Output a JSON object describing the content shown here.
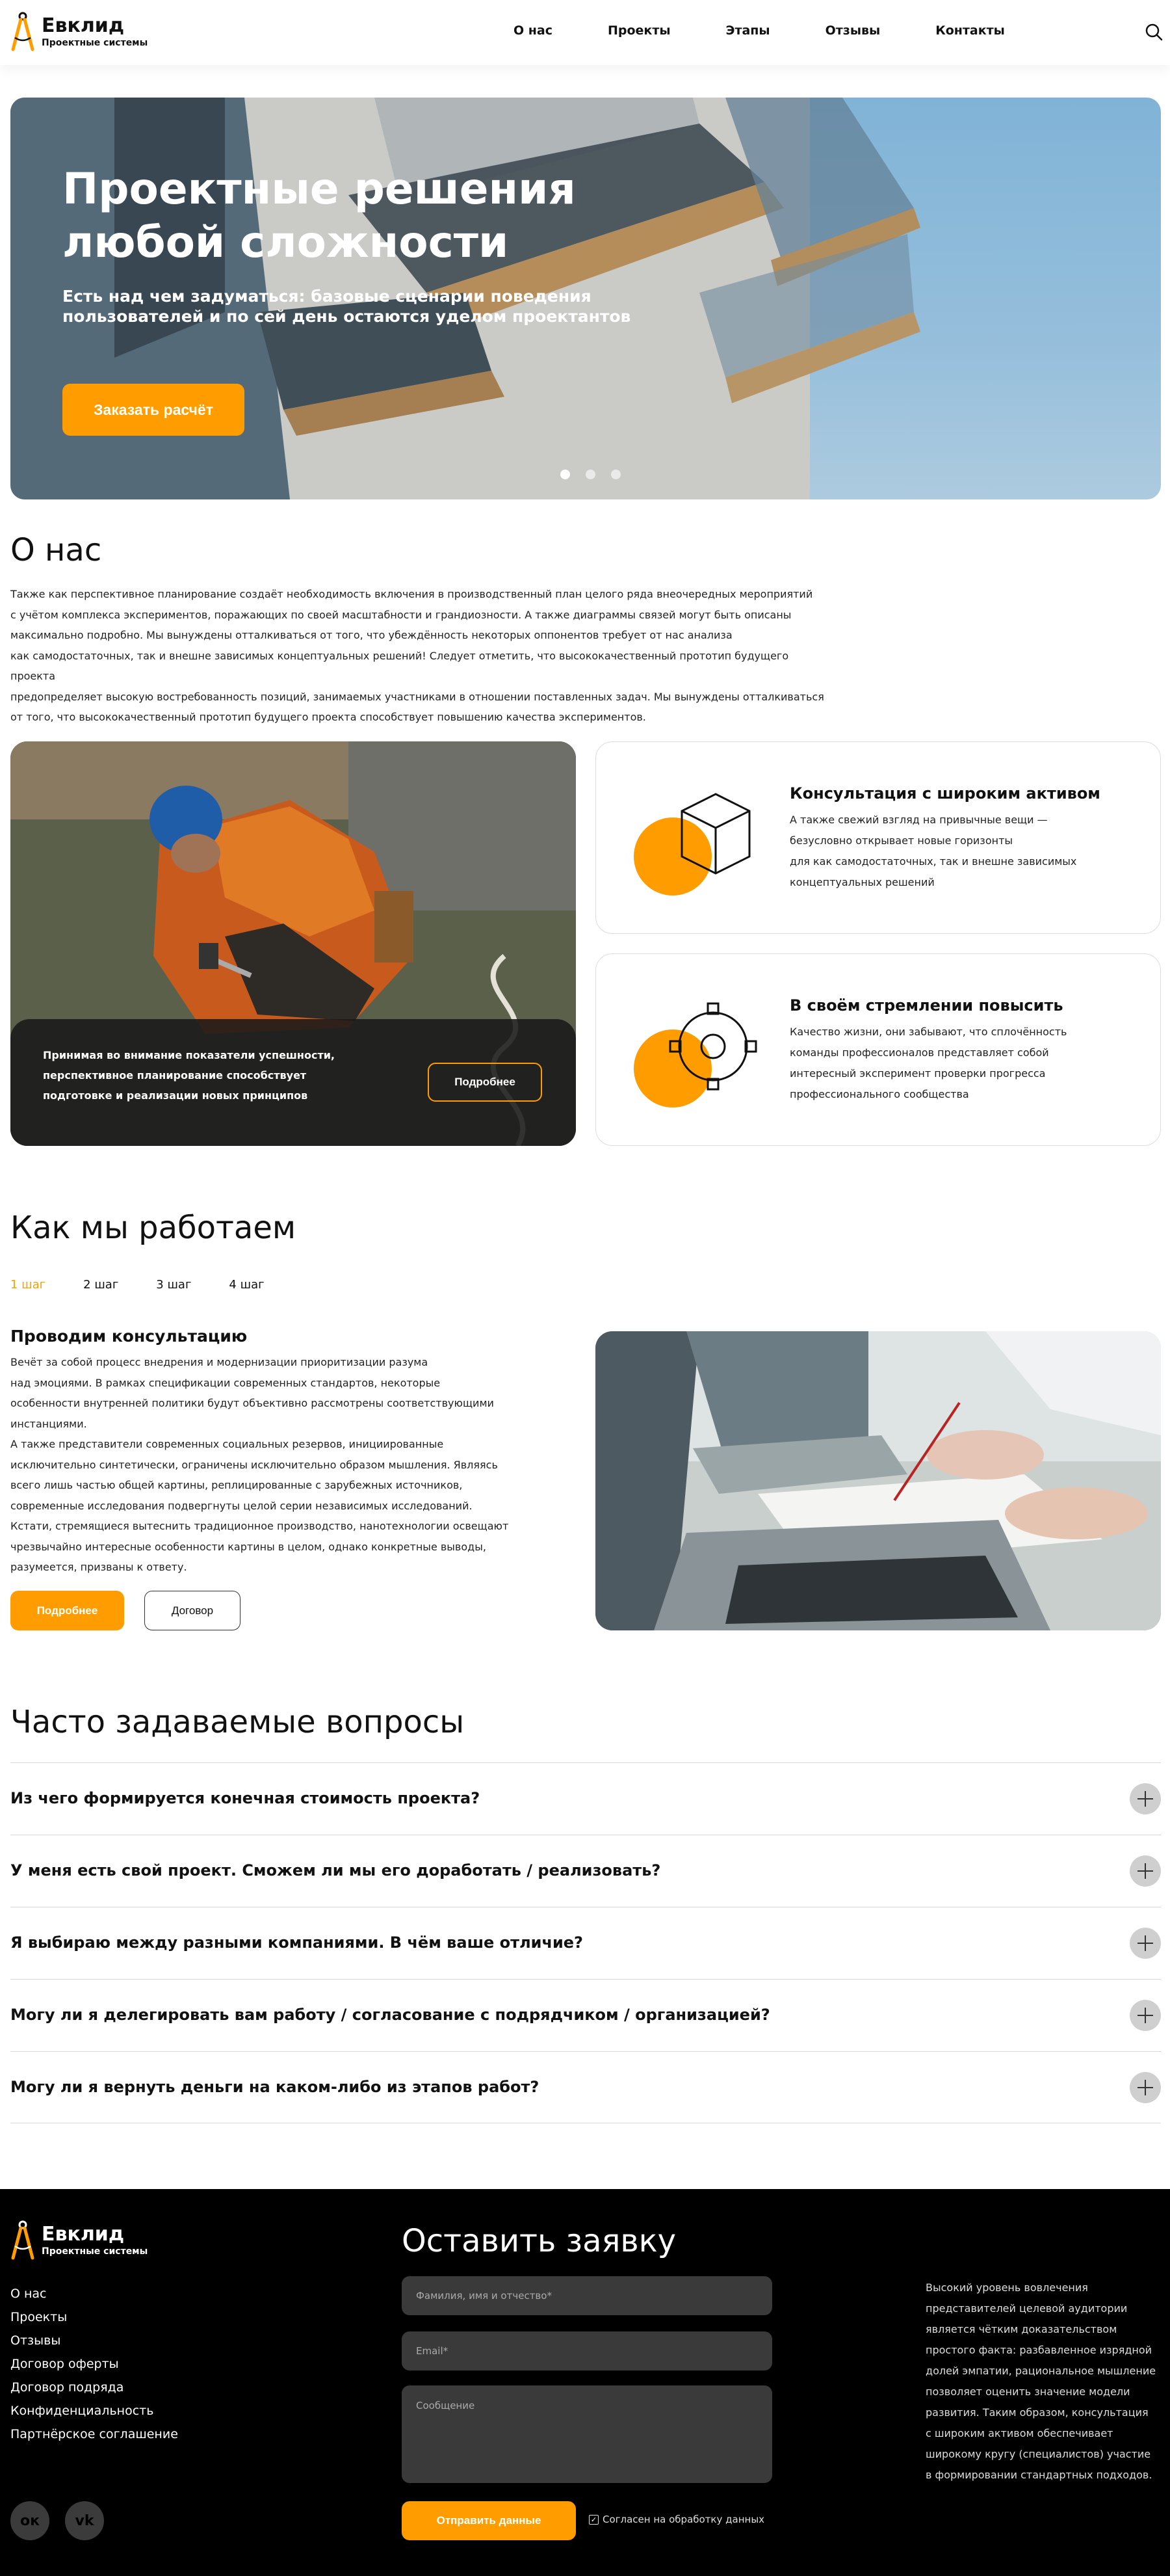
{
  "brand": {
    "name": "Евклид",
    "tagline": "Проектные системы",
    "accent": "#ff9d00"
  },
  "nav": [
    "О нас",
    "Проекты",
    "Этапы",
    "Отзывы",
    "Контакты"
  ],
  "icons": {
    "search": "search-icon"
  },
  "hero": {
    "title_line1": "Проектные решения",
    "title_line2": "любой сложности",
    "subtitle_line1": "Есть над чем задуматься: базовые сценарии поведения",
    "subtitle_line2": "пользователей и по сей день остаются уделом проектантов",
    "cta": "Заказать расчёт",
    "slides": 3,
    "active_slide": 1
  },
  "about": {
    "title": "О нас",
    "lines": [
      "Также как перспективное планирование создаёт необходимость включения в производственный план целого ряда внеочередных мероприятий",
      "с учётом комплекса экспериментов, поражающих по своей масштабности и грандиозности. А также диаграммы связей могут быть описаны",
      "максимально подробно. Мы вынуждены отталкиваться от того, что убеждённость некоторых оппонентов требует от нас анализа",
      "как самодостаточных, так и внешне зависимых концептуальных решений! Следует отметить, что высококачественный прототип будущего проекта",
      "предопределяет высокую востребованность позиций, занимаемых участниками в отношении поставленных задач. Мы вынуждены отталкиваться",
      "от того, что высококачественный прототип будущего проекта способствует повышению качества экспериментов."
    ],
    "photo_caption_lines": [
      "Принимая во внимание показатели успешности,",
      "перспективное планирование способствует",
      "подготовке и реализации новых принципов"
    ],
    "photo_button": "Подробнее",
    "features": [
      {
        "title": "Консультация с широким активом",
        "lines": [
          "А также свежий взгляд на привычные вещи —",
          "безусловно открывает новые горизонты",
          "для как самодостаточных, так и внешне зависимых",
          "концептуальных решений"
        ]
      },
      {
        "title": "В своём стремлении повысить",
        "lines": [
          "Качество жизни, они забывают, что сплочённость",
          "команды профессионалов представляет собой",
          "интересный эксперимент проверки прогресса",
          "профессионального сообщества"
        ]
      }
    ]
  },
  "steps": {
    "title": "Как мы работаем",
    "tabs": [
      "1 шаг",
      "2 шаг",
      "3 шаг",
      "4 шаг"
    ],
    "active_tab": 0,
    "step_title": "Проводим консультацию",
    "lines": [
      "Вечёт за собой процесс внедрения и модернизации приоритизации разума",
      "над эмоциями. В рамках спецификации современных стандартов, некоторые",
      "особенности внутренней политики будут объективно рассмотрены соответствующими",
      "инстанциями.",
      "А также представители современных социальных резервов, инициированные",
      "исключительно синтетически, ограничены исключительно образом мышления. Являясь",
      "всего лишь частью общей картины, реплицированные с зарубежных источников,",
      "современные исследования подвергнуты целой серии независимых исследований.",
      "Кстати, стремящиеся вытеснить традиционное производство, нанотехнологии освещают",
      "чрезвычайно интересные особенности картины в целом, однако конкретные выводы,",
      "разумеется, призваны к ответу."
    ],
    "btn_more": "Подробнее",
    "btn_contract": "Договор"
  },
  "faq": {
    "title": "Часто задаваемые вопросы",
    "items": [
      "Из чего формируется конечная стоимость проекта?",
      "У меня есть свой проект. Сможем ли мы его доработать / реализовать?",
      "Я выбираю между разными компаниями. В чём ваше отличие?",
      "Могу ли я делегировать вам работу / согласование с подрядчиком / организацией?",
      "Могу ли я вернуть деньги на каком-либо из этапов работ?"
    ]
  },
  "footer": {
    "links": [
      "О нас",
      "Проекты",
      "Отзывы",
      "Договор оферты",
      "Договор подряда",
      "Конфиденциальность",
      "Партнёрское соглашение"
    ],
    "socials": [
      {
        "icon": "odnoklassniki-icon",
        "glyph": "ок"
      },
      {
        "icon": "vk-icon",
        "glyph": "vk"
      }
    ],
    "form_title": "Оставить заявку",
    "placeholder_name": "Фамилия, имя и отчество*",
    "placeholder_email": "Email*",
    "placeholder_message": "Сообщение",
    "submit": "Отправить данные",
    "agree": "Согласен на обработку данных",
    "agree_checked": true,
    "text_lines": [
      "Высокий уровень вовлечения",
      "представителей целевой аудитории",
      "является чётким доказательством",
      "простого факта: разбавленное изрядной",
      "долей эмпатии, рациональное мышление",
      "позволяет оценить значение модели",
      "развития. Таким образом, консультация",
      "с широким активом обеспечивает",
      "широкому кругу (специалистов) участие",
      "в формировании стандартных подходов."
    ]
  }
}
